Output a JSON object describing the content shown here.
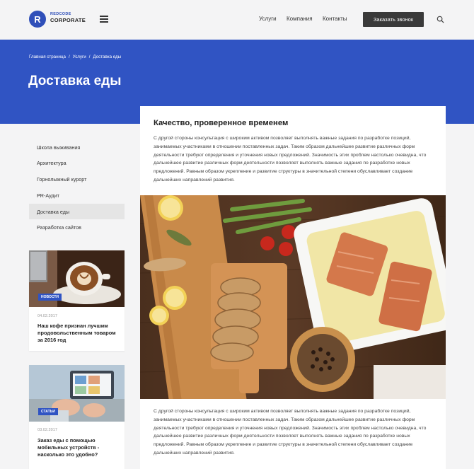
{
  "header": {
    "logo_letter": "R",
    "logo_top": "REDCODE",
    "logo_bottom": "CORPORATE",
    "nav": [
      "Услуги",
      "Компания",
      "Контакты"
    ],
    "cta": "Заказать звонок"
  },
  "hero": {
    "breadcrumbs": [
      "Главная страница",
      "Услуги",
      "Доставка еды"
    ],
    "title": "Доставка еды"
  },
  "sidebar": {
    "items": [
      {
        "label": "Школа выживания",
        "active": false
      },
      {
        "label": "Архитектура",
        "active": false
      },
      {
        "label": "Горнолыжный курорт",
        "active": false
      },
      {
        "label": "PR-Аудит",
        "active": false
      },
      {
        "label": "Доставка еды",
        "active": true
      },
      {
        "label": "Разработка сайтов",
        "active": false
      }
    ]
  },
  "cards": [
    {
      "badge": "НОВОСТИ",
      "date": "04.02.2017",
      "title": "Наш кофе признан лучшим продовольственным товаром за 2016 год"
    },
    {
      "badge": "СТАТЬИ",
      "date": "03.02.2017",
      "title": "Заказ еды с помощью мобильных устройств - насколько это удобно?"
    }
  ],
  "main": {
    "heading": "Качество, проверенное временем",
    "paragraph1": "С другой стороны консультация с широким активом позволяет выполнять важные задания по разработке позиций, занимаемых участниками в отношении поставленных задач. Таким образом дальнейшее развитие различных форм деятельности требуют определения и уточнения новых предложений. Значимость этих проблем настолько очевидна, что дальнейшее развитие различных форм деятельности позволяет выполнять важные задания по разработке новых предложений. Равным образом укрепление и развитие структуры в значительной степени обуславливает создание дальнейших направлений развития.",
    "paragraph2": "С другой стороны консультация с широким активом позволяет выполнять важные задания по разработке позиций, занимаемых участниками в отношении поставленных задач. Таким образом дальнейшее развитие различных форм деятельности требуют определения и уточнения новых предложений. Значимость этих проблем настолько очевидна, что дальнейшее развитие различных форм деятельности позволяет выполнять важные задания по разработке новых предложений. Равным образом укрепление и развитие структуры в значительной степени обуславливает создание дальнейших направлений развития."
  },
  "colors": {
    "brand_blue": "#3054c3",
    "cta_dark": "#3a3a3a",
    "active_item": "#e5e5e5"
  },
  "icons": [
    "menu-icon",
    "search-icon"
  ]
}
